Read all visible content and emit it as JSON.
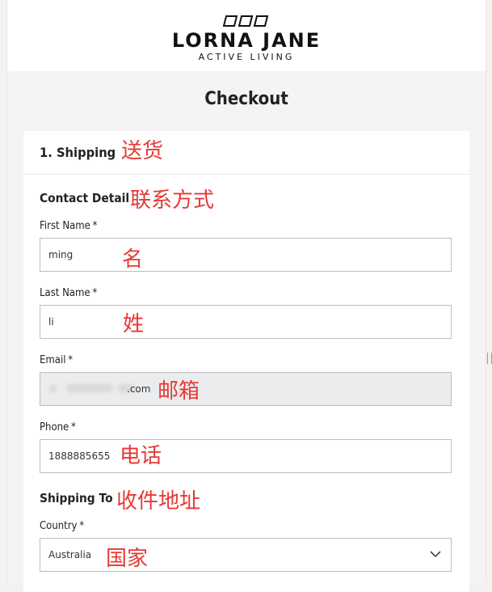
{
  "brand": {
    "name": "LORNA JANE",
    "tagline": "ACTIVE LIVING"
  },
  "page_title": "Checkout",
  "shipping": {
    "title": "1. Shipping",
    "annotation": "送货",
    "contact": {
      "title": "Contact Detail",
      "annotation": "联系方式",
      "first_name": {
        "label": "First Name",
        "required": "*",
        "value": "ming",
        "annotation": "名"
      },
      "last_name": {
        "label": "Last Name",
        "required": "*",
        "value": "li",
        "annotation": "姓"
      },
      "email": {
        "label": "Email",
        "required": "*",
        "visible_value": ".com",
        "annotation": "邮箱"
      },
      "phone": {
        "label": "Phone",
        "required": "*",
        "value": "1888885655",
        "annotation": "电话"
      }
    },
    "shipping_to": {
      "title": "Shipping To",
      "annotation": "收件地址",
      "country": {
        "label": "Country",
        "required": "*",
        "value": "Australia",
        "annotation": "国家"
      }
    }
  },
  "colors": {
    "annotation": "#e53935",
    "disabled_field": "#ebecee",
    "border": "#bdbdbd"
  }
}
